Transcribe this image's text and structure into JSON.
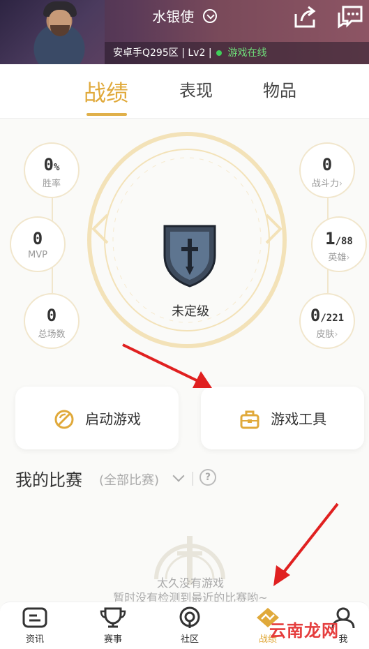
{
  "header": {
    "title": "水银使",
    "server": "安卓手Q295区",
    "level": "Lv2",
    "status": "游戏在线"
  },
  "tabs": [
    "战绩",
    "表现",
    "物品"
  ],
  "stats": {
    "win_rate": {
      "value": "0",
      "unit": "%",
      "label": "胜率"
    },
    "mvp": {
      "value": "0",
      "label": "MVP"
    },
    "total_games": {
      "value": "0",
      "label": "总场数"
    },
    "power": {
      "value": "0",
      "label": "战斗力"
    },
    "heroes": {
      "value": "1",
      "total": "/88",
      "label": "英雄"
    },
    "skins": {
      "value": "0",
      "total": "/221",
      "label": "皮肤"
    }
  },
  "rank": {
    "label": "未定级"
  },
  "actions": {
    "launch": "启动游戏",
    "tools": "游戏工具"
  },
  "matches": {
    "title": "我的比赛",
    "filter": "(全部比赛)",
    "empty_line1": "太久没有游戏",
    "empty_line2": "暂时没有检测到最近的比赛哟~"
  },
  "nav": [
    "资讯",
    "赛事",
    "社区",
    "战绩",
    "我"
  ],
  "watermark": "云南龙网",
  "colors": {
    "accent": "#e0a93a",
    "arrow": "#e02020",
    "online": "#3fd05a"
  }
}
